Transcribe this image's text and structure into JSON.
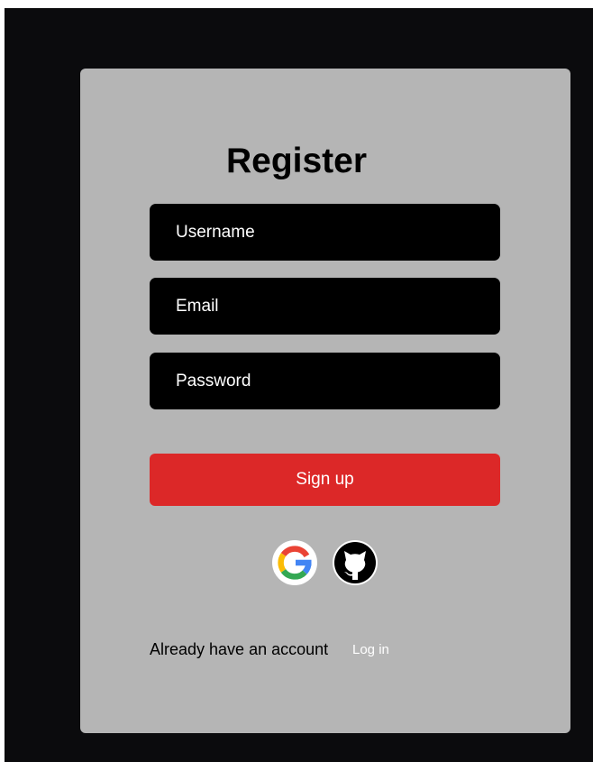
{
  "form": {
    "title": "Register",
    "username_placeholder": "Username",
    "email_placeholder": "Email",
    "password_placeholder": "Password",
    "signup_label": "Sign up"
  },
  "social": {
    "google_icon": "google-icon",
    "github_icon": "github-icon"
  },
  "footer": {
    "prompt": "Already have an account",
    "login_label": "Log in"
  },
  "colors": {
    "page_background": "#0b0b0d",
    "card_background": "#b5b5b5",
    "input_background": "#000000",
    "button_red": "#dc2828",
    "text_white": "#ffffff"
  }
}
